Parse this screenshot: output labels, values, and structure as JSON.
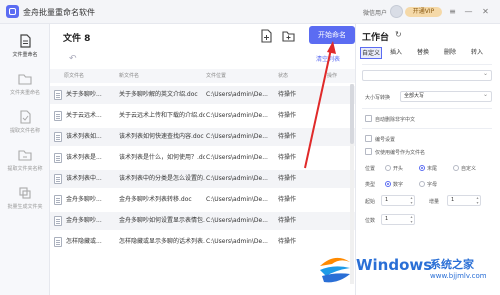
{
  "app": {
    "title": "金舟批量重命名软件",
    "user": "微信用户",
    "vip": "开通VIP"
  },
  "nav": [
    {
      "label": "文件重命名",
      "icon": "doc-icon"
    },
    {
      "label": "文件夹重命名",
      "icon": "folder-icon"
    },
    {
      "label": "提取文件名称",
      "icon": "extract-icon"
    },
    {
      "label": "提取文件夹名称",
      "icon": "extract-folder-icon"
    },
    {
      "label": "批量生成文件夹",
      "icon": "generate-folder-icon"
    }
  ],
  "files": {
    "title": "文件 8",
    "start_button": "开始命名",
    "clear_label": "清空列表",
    "columns": [
      "原文件名",
      "新文件名",
      "文件位置",
      "状态",
      "操作"
    ],
    "rows": [
      {
        "orig": "关于多聊吵...",
        "new": "关于多聊吵解的英文介绍.doc",
        "path": "C:\\Users\\admin\\De...",
        "status": "待操作"
      },
      {
        "orig": "关于云远术...",
        "new": "关于云远术上传和下载的介绍.doc",
        "path": "C:\\Users\\admin\\De...",
        "status": "待操作"
      },
      {
        "orig": "该术列表如...",
        "new": "该术列表如何快速查找内容.doc",
        "path": "C:\\Users\\admin\\De...",
        "status": "待操作"
      },
      {
        "orig": "该术列表是...",
        "new": "该术列表是什么，如何使用？.doc",
        "path": "C:\\Users\\admin\\De...",
        "status": "待操作"
      },
      {
        "orig": "该术列表中...",
        "new": "该术列表中的分类是怎么设置的...",
        "path": "C:\\Users\\admin\\De...",
        "status": "待操作"
      },
      {
        "orig": "金舟多聊吵...",
        "new": "金舟多聊吵术列表转移.doc",
        "path": "C:\\Users\\admin\\De...",
        "status": "待操作"
      },
      {
        "orig": "金舟多聊吵...",
        "new": "金舟多聊吵如何设置显示表情包...",
        "path": "C:\\Users\\admin\\De...",
        "status": "待操作"
      },
      {
        "orig": "怎样隐藏或...",
        "new": "怎样隐藏或显示多聊的话术列表...",
        "path": "C:\\Users\\admin\\De...",
        "status": "待操作"
      }
    ]
  },
  "panel": {
    "title": "工作台",
    "tabs": [
      "自定义",
      "插入",
      "替换",
      "删除",
      "转入"
    ],
    "case_label": "大小写转换",
    "case_value": "全部大写",
    "auto_rename_label": "自动删除非字中文",
    "numbering_label": "编号设置",
    "keep_name_label": "仅使用编号作为文件名",
    "position_label": "位置",
    "position_options": [
      "开头",
      "末尾",
      "自定义"
    ],
    "type_label": "类型",
    "type_options": [
      "数字",
      "字母"
    ],
    "start_label": "起始",
    "start_value": "1",
    "step_label": "增量",
    "step_value": "1",
    "digits_label": "位数",
    "digits_value": "1"
  },
  "watermark": {
    "brand": "Windows",
    "sub": "系统之家",
    "url": "www.bjjmlv.com"
  }
}
